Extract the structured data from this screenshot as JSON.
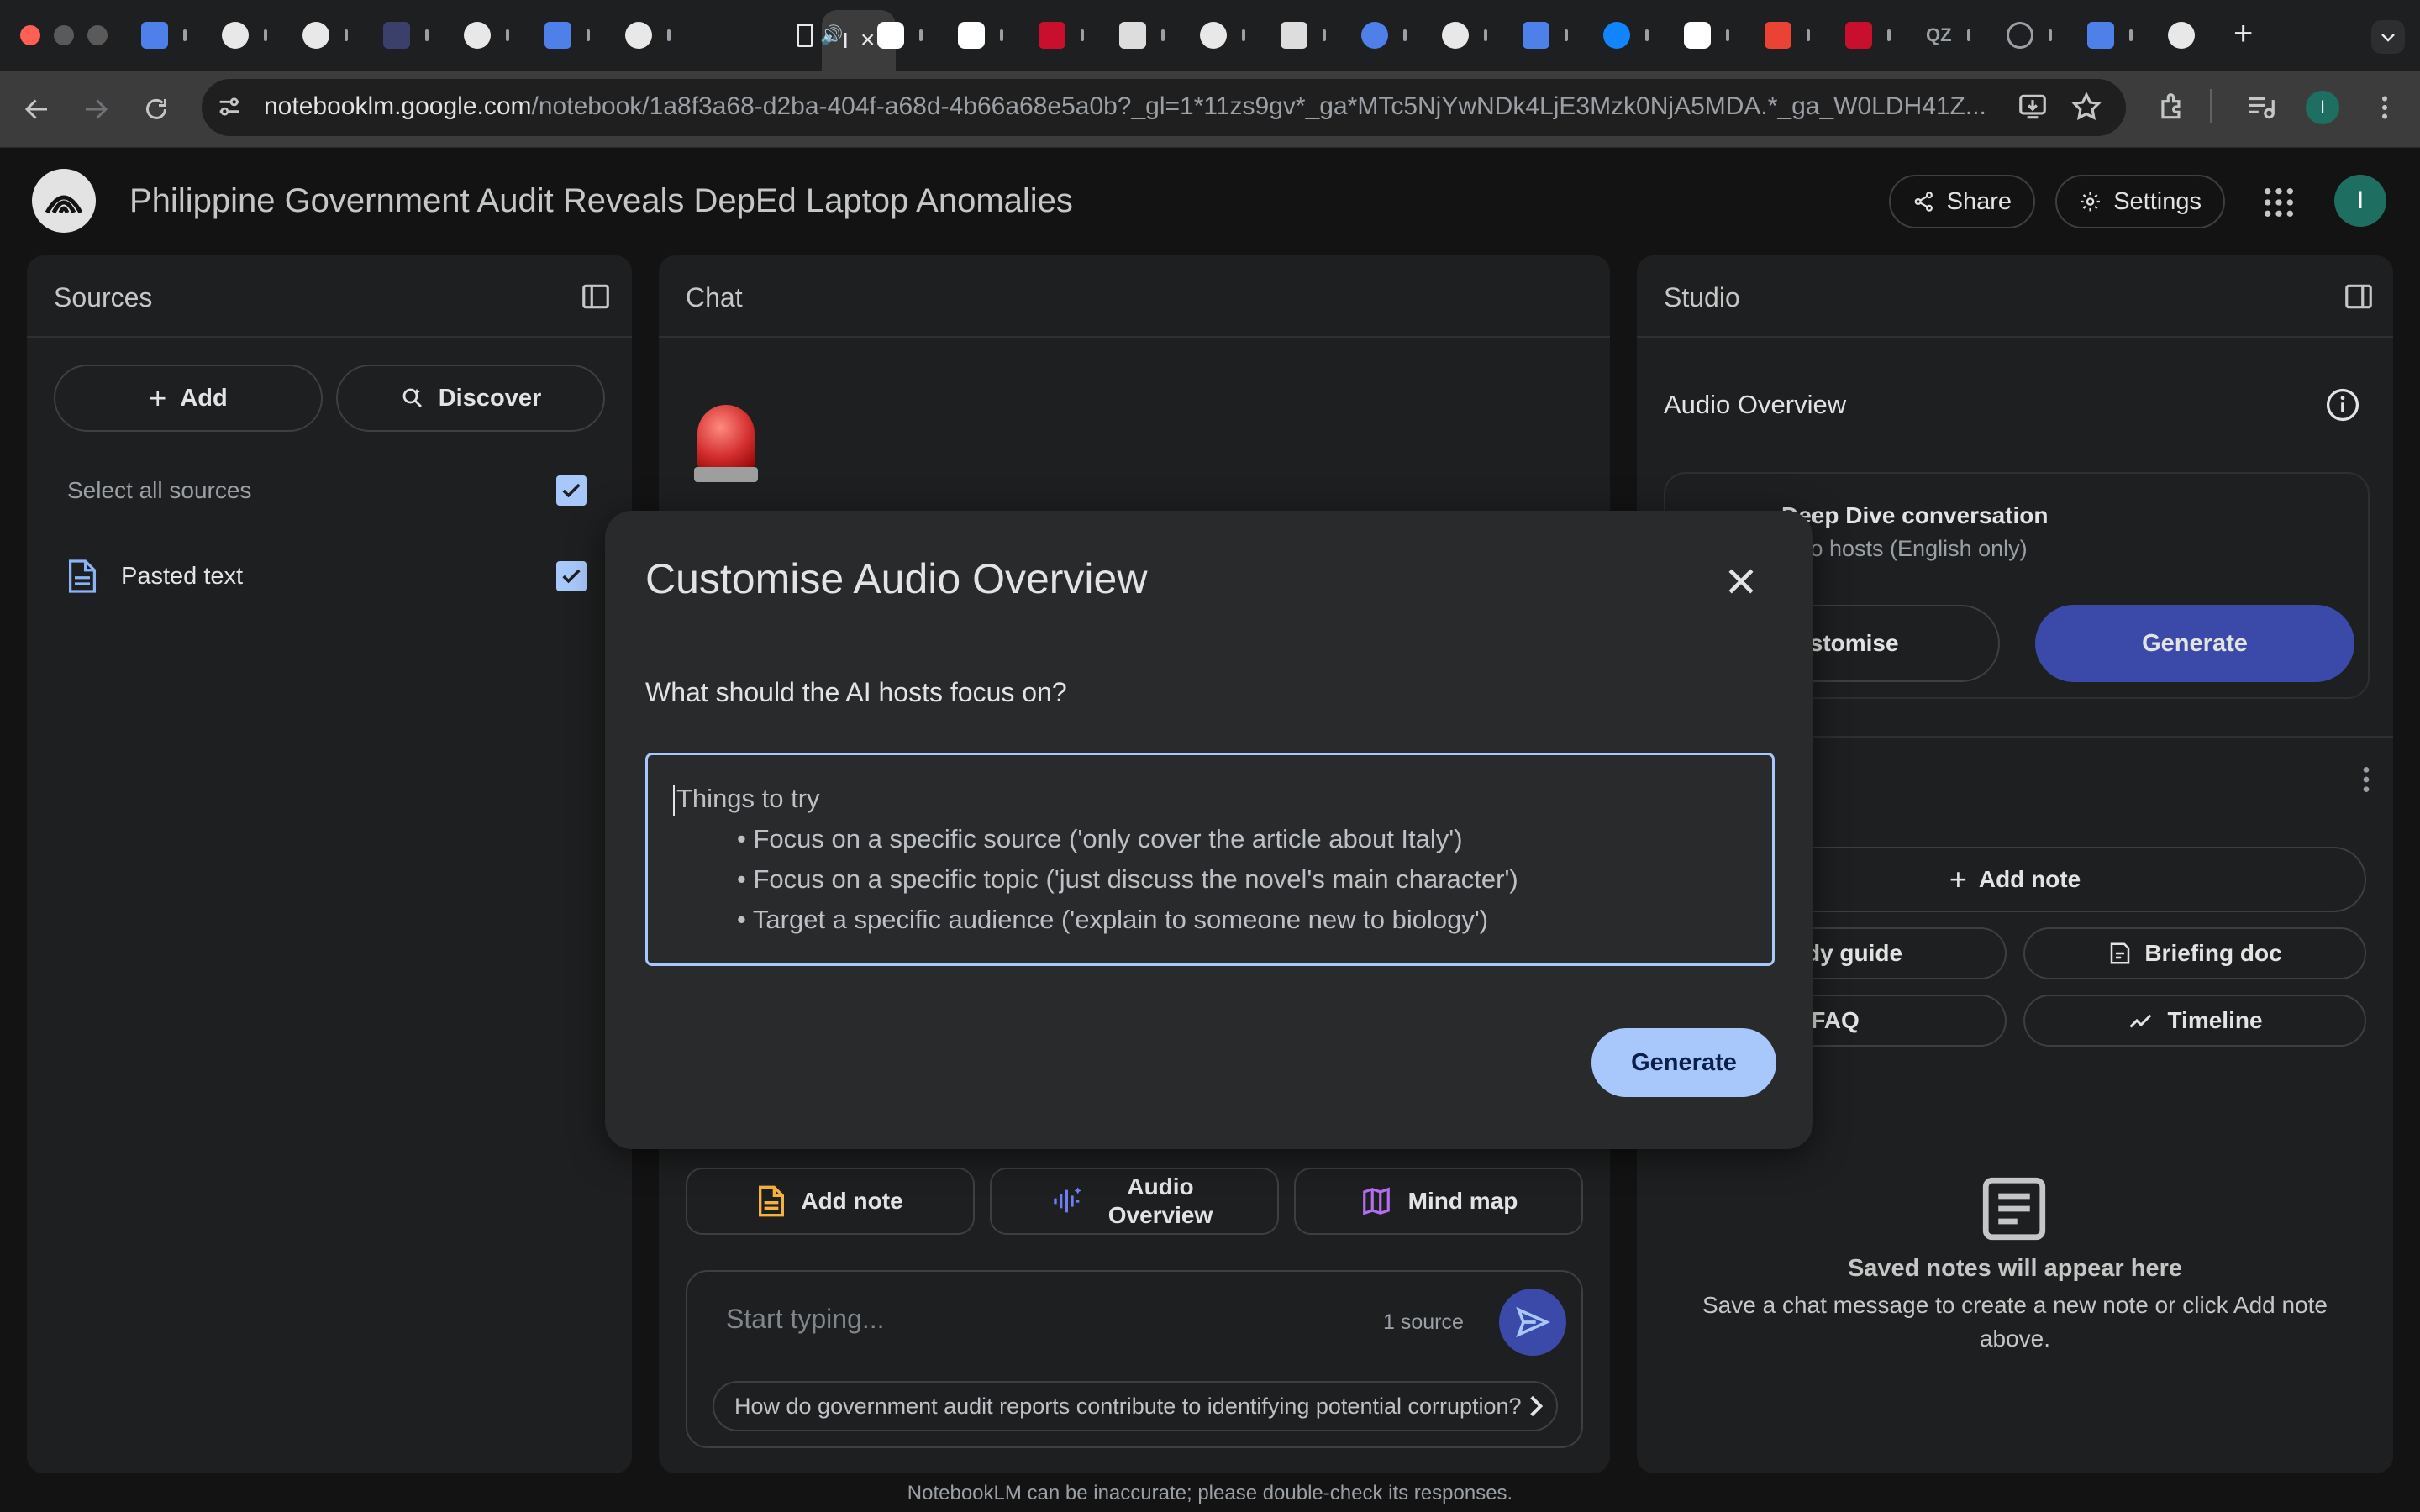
{
  "browser": {
    "url_host": "notebooklm.google.com",
    "url_path": "/notebook/1a8f3a68-d2ba-404f-a68d-4b66a68e5a0b?_gl=1*11zs9gv*_ga*MTc5NjYwNDk4LjE3Mzk0NjA5MDA.*_ga_W0LDH41Z...",
    "active_tab_label": "I",
    "new_tab_label": "+",
    "tab_favicons": [
      "docs-icon",
      "wordpress-icon",
      "github-icon",
      "image-icon",
      "openai-icon",
      "docs-icon",
      "github-icon",
      "notebooklm-tab",
      "audio-tab",
      "pause-icon",
      "pause-icon",
      "maryland-icon",
      "image-icon",
      "openai-icon",
      "image-icon",
      "chatgpt-icon",
      "openai-icon",
      "docs-icon",
      "bluesky-icon",
      "pause-icon",
      "gmail-icon",
      "maryland-icon",
      "qz-icon",
      "compass-icon",
      "docs-icon",
      "openai-icon"
    ],
    "tab_glyphs": {
      "qz": "QZ"
    }
  },
  "header": {
    "title": "Philippine Government Audit Reveals DepEd Laptop Anomalies",
    "share_label": "Share",
    "settings_label": "Settings",
    "avatar_letter": "I"
  },
  "sources": {
    "title": "Sources",
    "add_label": "Add",
    "discover_label": "Discover",
    "select_all_label": "Select all sources",
    "items": [
      {
        "label": "Pasted text"
      }
    ]
  },
  "chat": {
    "title": "Chat",
    "add_note_label": "Add note",
    "audio_overview_label": "Audio Overview",
    "mind_map_label": "Mind map",
    "input_placeholder": "Start typing...",
    "source_count": "1 source",
    "suggestion": "How do government audit reports contribute to identifying potential corruption?"
  },
  "studio": {
    "title": "Studio",
    "audio_overview_title": "Audio Overview",
    "deep_dive_title": "Deep Dive conversation",
    "deep_dive_subtitle": "Two hosts (English only)",
    "customise_label": "Customise",
    "generate_label": "Generate",
    "add_note_label": "Add note",
    "study_guide_label": "Study guide",
    "briefing_doc_label": "Briefing doc",
    "faq_label": "FAQ",
    "timeline_label": "Timeline",
    "empty_title": "Saved notes will appear here",
    "empty_body": "Save a chat message to create a new note or click Add note above."
  },
  "modal": {
    "title": "Customise Audio Overview",
    "question": "What should the AI hosts focus on?",
    "placeholder_heading": "Things to try",
    "placeholder_items": [
      "• Focus on a specific source ('only cover the article about Italy')",
      "• Focus on a specific topic ('just discuss the novel's main character')",
      "• Target a specific audience ('explain to someone new to biology')"
    ],
    "generate_label": "Generate"
  },
  "footer": {
    "disclaimer": "NotebookLM can be inaccurate; please double-check its responses."
  },
  "colors": {
    "accent_light": "#a8c7fa",
    "accent_dark": "#3b4aa8",
    "panel_bg": "#1e1f20",
    "page_bg": "#131313"
  }
}
